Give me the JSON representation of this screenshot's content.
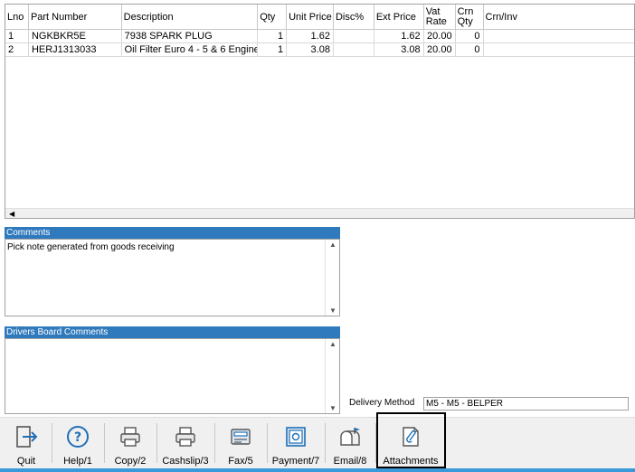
{
  "grid": {
    "headers": {
      "lno": "Lno",
      "part": "Part Number",
      "desc": "Description",
      "qty": "Qty",
      "unit_price": "Unit Price",
      "disc": "Disc%",
      "ext_price": "Ext Price",
      "vat_1": "Vat",
      "vat_2": "Rate",
      "crn_1": "Crn",
      "crn_2": "Qty",
      "crn_inv": "Crn/Inv"
    },
    "rows": [
      {
        "lno": "1",
        "part": "NGKBKR5E",
        "desc": "7938 SPARK PLUG",
        "qty": "1",
        "unit_price": "1.62",
        "disc": "",
        "ext_price": "1.62",
        "vat": "20.00",
        "crn_qty": "0",
        "crn_inv": ""
      },
      {
        "lno": "2",
        "part": "HERJ1313033",
        "desc": "Oil Filter Euro 4 - 5 & 6 Engine",
        "qty": "1",
        "unit_price": "3.08",
        "disc": "",
        "ext_price": "3.08",
        "vat": "20.00",
        "crn_qty": "0",
        "crn_inv": ""
      }
    ]
  },
  "comments": {
    "title": "Comments",
    "text": "Pick note generated from goods receiving"
  },
  "drivers": {
    "title": "Drivers Board Comments",
    "text": ""
  },
  "delivery": {
    "label": "Delivery Method",
    "value": "M5 - M5 - BELPER"
  },
  "toolbar": {
    "quit": "Quit",
    "help": "Help/1",
    "copy": "Copy/2",
    "cashslip": "Cashslip/3",
    "fax": "Fax/5",
    "payment": "Payment/7",
    "email": "Email/8",
    "attachments": "Attachments"
  },
  "colors": {
    "panel_header": "#2f79bd",
    "icon_blue": "#1f6fb5",
    "toolbar_bg": "#f0f0f0",
    "highlight_border": "#000000"
  }
}
